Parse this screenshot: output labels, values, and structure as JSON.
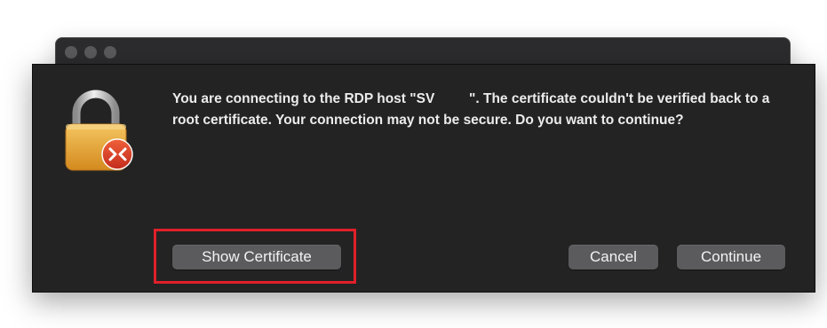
{
  "window": {
    "traffic_lights": [
      "close",
      "minimize",
      "zoom"
    ]
  },
  "dialog": {
    "icon": "lock-remote-desktop-icon",
    "message": "You are connecting to the RDP host \"SV         \". The certificate couldn't be verified back to a root certificate. Your connection may not be secure. Do you want to continue?",
    "buttons": {
      "show_certificate": "Show Certificate",
      "cancel": "Cancel",
      "continue": "Continue"
    }
  },
  "annotation": {
    "highlight_color": "#e0202a",
    "highlighted_target": "show-certificate-button"
  }
}
